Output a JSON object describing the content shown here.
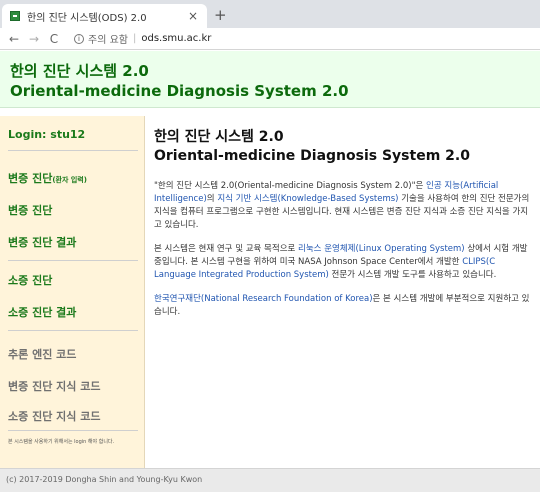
{
  "browser": {
    "tab_title": "한의 진단 시스템(ODS) 2.0",
    "tab_close": "×",
    "new_tab": "+",
    "back": "←",
    "forward": "→",
    "reload": "C",
    "security_label": "주의 요함",
    "url": "ods.smu.ac.kr"
  },
  "header": {
    "title_ko": "한의 진단 시스템 2.0",
    "title_en": "Oriental-medicine Diagnosis System 2.0"
  },
  "sidebar": {
    "login": "Login: stu12",
    "items": [
      {
        "label": "변증 진단",
        "sub": "(환자 입력)"
      },
      {
        "label": "변증 진단"
      },
      {
        "label": "변증 진단 결과"
      },
      {
        "label": "소증 진단"
      },
      {
        "label": "소증 진단 결과"
      }
    ],
    "gray_items": [
      {
        "label": "추론 엔진 코드"
      },
      {
        "label": "변증 진단 지식 코드"
      },
      {
        "label": "소증 진단 지식 코드"
      }
    ],
    "note": "본 시스템을 사용하기 위해서는 login 해야 합니다."
  },
  "main": {
    "title_ko": "한의 진단 시스템 2.0",
    "title_en": "Oriental-medicine Diagnosis System 2.0",
    "p1": {
      "t1": "\"한의 진단 시스템 2.0(Oriental-medicine Diagnosis System 2.0)\"은 ",
      "l1": "인공 지능(Artificial Intelligence)",
      "t2": "의 ",
      "l2": "지식 기반 시스템(Knowledge-Based Systems)",
      "t3": " 기술을 사용하여 한의 진단 전문가의 지식을 컴퓨터 프로그램으로 구현한 시스템입니다. 현재 시스템은 변증 진단 지식과 소증 진단 지식을 가지고 있습니다."
    },
    "p2": {
      "t1": "본 시스템은 현재 연구 및 교육 목적으로 ",
      "l1": "리눅스 운영체제(Linux Operating System)",
      "t2": " 상에서 시험 개발 중입니다. 본 시스템 구현을 위하여 미국 NASA Johnson Space Center에서 개발한 ",
      "l2": "CLIPS(C Language Integrated Production System)",
      "t3": " 전문가 시스템 개발 도구를 사용하고 있습니다."
    },
    "p3": {
      "l1": "한국연구재단(National Research Foundation of Korea)",
      "t1": "은 본 시스템 개발에 부분적으로 지원하고 있습니다."
    }
  },
  "footer": {
    "text": "(c) 2017-2019 Dongha Shin and Young-Kyu Kwon"
  }
}
